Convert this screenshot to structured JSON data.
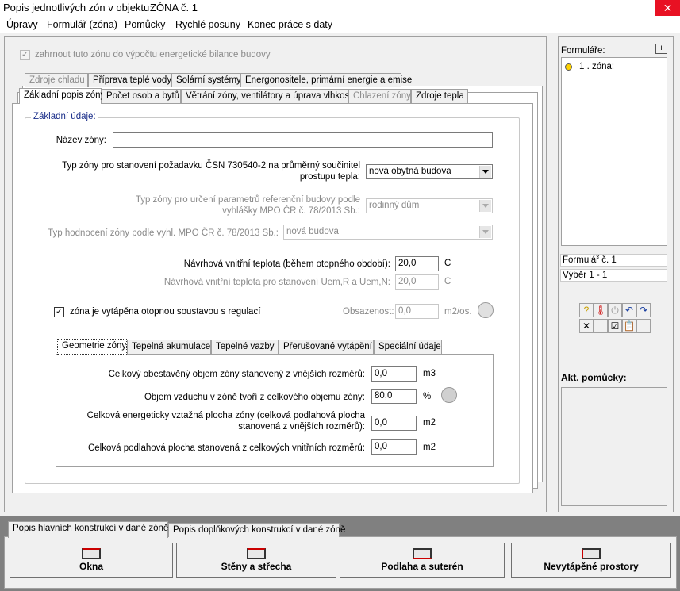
{
  "title": {
    "left": "Popis jednotlivých zón v objektu:",
    "right": "ZÓNA č. 1"
  },
  "menu": [
    "Úpravy",
    "Formulář (zóna)",
    "Pomůcky",
    "Rychlé posuny",
    "Konec práce s daty"
  ],
  "include_zone_label": "zahrnout tuto zónu do výpočtu energetické bilance budovy",
  "tabs_back": [
    "Zdroje chladu",
    "Příprava teplé vody",
    "Solární systémy",
    "Energonositele, primární energie a emise"
  ],
  "tabs_front": [
    "Základní popis zóny",
    "Počet osob a bytů",
    "Větrání zóny, ventilátory a úprava vlhkosti",
    "Chlazení zóny",
    "Zdroje tepla"
  ],
  "group_title": "Základní údaje:",
  "zone_name": {
    "label": "Název zóny:",
    "value": ""
  },
  "zone_type": {
    "label_line1": "Typ zóny pro stanovení požadavku ČSN 730540-2 na průměrný součinitel",
    "label_line2": "prostupu tepla:",
    "value": "nová obytná budova"
  },
  "ref_type": {
    "label_line1": "Typ zóny pro určení parametrů referenční budovy podle",
    "label_line2": "vyhlášky MPO ČR č. 78/2013 Sb.:",
    "value": "rodinný dům"
  },
  "eval_type": {
    "label": "Typ hodnocení zóny podle vyhl. MPO ČR č. 78/2013 Sb.:",
    "value": "nová budova"
  },
  "design_temp": {
    "label": "Návrhová vnitřní teplota (během otopného období):",
    "value": "20,0",
    "unit": "C"
  },
  "design_temp_uem": {
    "label": "Návrhová vnitřní teplota pro stanovení Uem,R a Uem,N:",
    "value": "20,0",
    "unit": "C"
  },
  "heated_label": "zóna je vytápěna otopnou soustavou s regulací",
  "occupancy": {
    "label": "Obsazenost:",
    "value": "0,0",
    "unit": "m2/os."
  },
  "subtabs": [
    "Geometrie zóny",
    "Tepelná akumulace",
    "Tepelné vazby",
    "Přerušované vytápění",
    "Speciální údaje"
  ],
  "geometry": [
    {
      "label_line1": "Celkový obestavěný objem zóny stanovený z vnějších rozměrů:",
      "label_line2": "",
      "value": "0,0",
      "unit": "m3"
    },
    {
      "label_line1": "Objem vzduchu v zóně tvoří z celkového objemu zóny:",
      "label_line2": "",
      "value": "80,0",
      "unit": "%"
    },
    {
      "label_line1": "Celková energeticky vztažná plocha zóny (celková podlahová plocha",
      "label_line2": "stanovená z vnějších rozměrů):",
      "value": "0,0",
      "unit": "m2"
    },
    {
      "label_line1": "Celková podlahová plocha stanovená z celkových vnitřních rozměrů:",
      "label_line2": "",
      "value": "0,0",
      "unit": "m2"
    }
  ],
  "side": {
    "forms_label": "Formuláře:",
    "plus": "+",
    "zone_item": "1 . zóna:",
    "form_no": "Formulář č.  1",
    "selection": "Výběr  1 - 1",
    "aids_label": "Akt. pomůcky:"
  },
  "bottom_tabs": [
    "Popis hlavních konstrukcí v dané zóně",
    "Popis doplňkových konstrukcí v dané zóně"
  ],
  "bottom_buttons": [
    "Okna",
    "Stěny a střecha",
    "Podlaha a suterén",
    "Nevytápěné prostory"
  ]
}
